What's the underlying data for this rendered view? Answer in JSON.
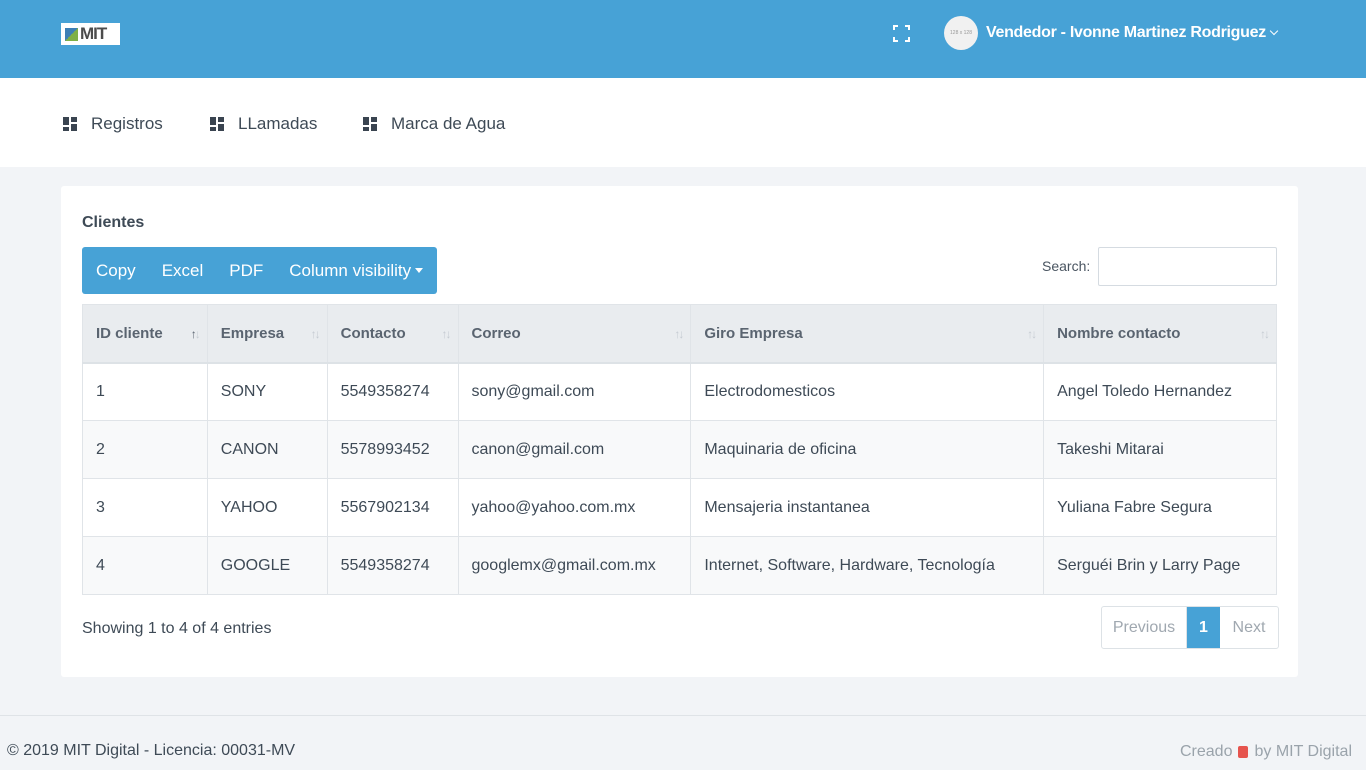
{
  "header": {
    "logo_text": "MIT",
    "avatar_text": "128 x 128",
    "user_name": "Vendedor - Ivonne Martinez Rodriguez"
  },
  "nav": {
    "items": [
      {
        "label": "Registros",
        "icon": "dashboard-icon"
      },
      {
        "label": "LLamadas",
        "icon": "dashboard-icon"
      },
      {
        "label": "Marca de Agua",
        "icon": "dashboard-icon"
      }
    ]
  },
  "card": {
    "title": "Clientes",
    "buttons": {
      "copy": "Copy",
      "excel": "Excel",
      "pdf": "PDF",
      "column_visibility": "Column visibility"
    },
    "search_label": "Search:",
    "table": {
      "columns": [
        "ID cliente",
        "Empresa",
        "Contacto",
        "Correo",
        "Giro Empresa",
        "Nombre contacto"
      ],
      "rows": [
        [
          "1",
          "SONY",
          "5549358274",
          "sony@gmail.com",
          "Electrodomesticos",
          "Angel Toledo Hernandez"
        ],
        [
          "2",
          "CANON",
          "5578993452",
          "canon@gmail.com",
          "Maquinaria de oficina",
          "Takeshi Mitarai"
        ],
        [
          "3",
          "YAHOO",
          "5567902134",
          "yahoo@yahoo.com.mx",
          "Mensajeria instantanea",
          "Yuliana Fabre Segura"
        ],
        [
          "4",
          "GOOGLE",
          "5549358274",
          "googlemx@gmail.com.mx",
          "Internet, Software, Hardware, Tecnología",
          "Serguéi Brin y Larry Page"
        ]
      ]
    },
    "info": "Showing 1 to 4 of 4 entries",
    "pagination": {
      "previous": "Previous",
      "current": "1",
      "next": "Next"
    }
  },
  "footer": {
    "copyright": "© 2019 MIT Digital - Licencia: 00031-MV",
    "credit_prefix": "Creado",
    "credit_suffix": "by MIT Digital"
  },
  "colors": {
    "primary": "#47a2d6",
    "heart": "#e6544e"
  }
}
